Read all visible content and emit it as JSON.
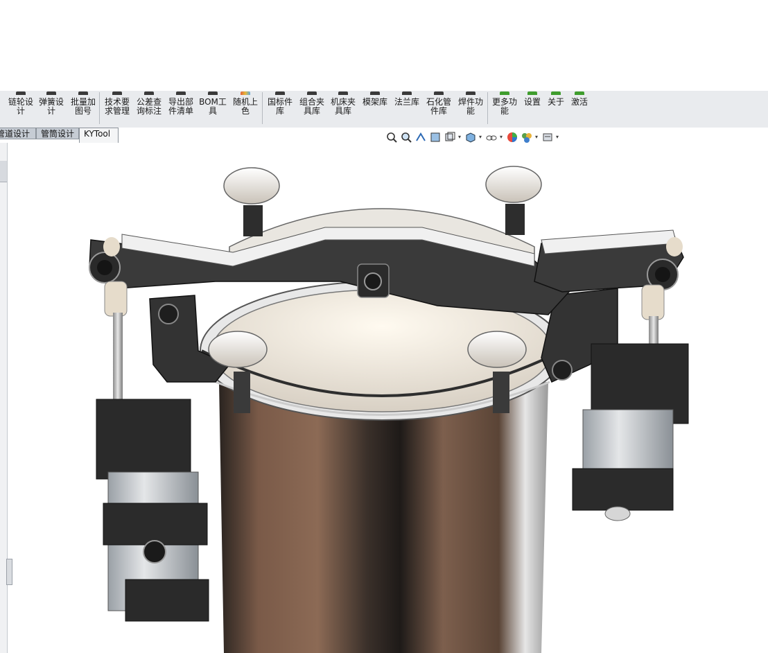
{
  "ribbon": {
    "buttons": [
      {
        "label": "链轮设\n计",
        "icon": "sprocket-icon"
      },
      {
        "label": "弹簧设\n计",
        "icon": "spring-icon"
      },
      {
        "label": "批量加\n图号",
        "icon": "drawing-number-icon"
      },
      {
        "label": "技术要\n求管理",
        "icon": "tech-requirements-icon"
      },
      {
        "label": "公差查\n询标注",
        "icon": "tolerance-icon"
      },
      {
        "label": "导出部\n件清单",
        "icon": "export-list-icon"
      },
      {
        "label": "BOM工\n具",
        "icon": "bom-icon"
      },
      {
        "label": "随机上\n色",
        "icon": "random-color-icon"
      },
      {
        "label": "国标件\n库",
        "icon": "standard-parts-icon"
      },
      {
        "label": "组合夹\n具库",
        "icon": "fixture-icon"
      },
      {
        "label": "机床夹\n具库",
        "icon": "machine-fixture-icon"
      },
      {
        "label": "模架库",
        "icon": "mold-base-icon"
      },
      {
        "label": "法兰库",
        "icon": "flange-icon"
      },
      {
        "label": "石化管\n件库",
        "icon": "pipe-fitting-icon"
      },
      {
        "label": "焊件功\n能",
        "icon": "weldment-icon"
      },
      {
        "label": "更多功\n能",
        "icon": "more-icon"
      },
      {
        "label": "设置",
        "icon": "settings-icon"
      },
      {
        "label": "关于",
        "icon": "info-icon"
      },
      {
        "label": "激活",
        "icon": "activate-icon"
      }
    ]
  },
  "tabs": [
    {
      "label": "管道设计"
    },
    {
      "label": "管筒设计"
    },
    {
      "label": "KYTool"
    }
  ],
  "view_toolbar": {
    "icons": [
      "zoom-to-fit-icon",
      "zoom-area-icon",
      "previous-view-icon",
      "section-view-icon",
      "view-orientation-icon",
      "display-style-icon",
      "hide-show-icon",
      "appearance-icon",
      "scene-icon",
      "view-settings-icon"
    ]
  },
  "colors": {
    "ribbon_bg": "#e9ebee",
    "tab_bg": "#c6ccd4",
    "active_tab_bg": "#f4f5f6",
    "model_arm": "#3b3b3b",
    "model_steel": "#d9d9d9",
    "model_tank": "#6e5040"
  }
}
